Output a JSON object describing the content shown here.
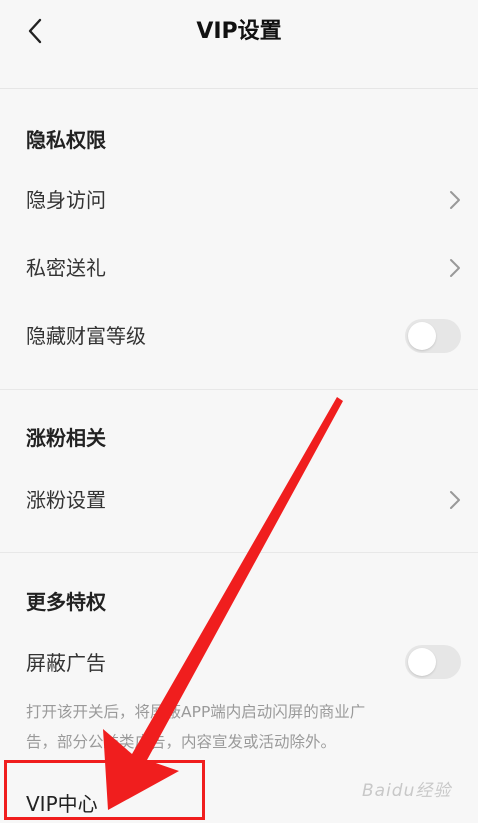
{
  "header": {
    "title": "VIP设置"
  },
  "sections": {
    "privacy": {
      "title": "隐私权限",
      "items": [
        {
          "label": "隐身访问"
        },
        {
          "label": "私密送礼"
        },
        {
          "label": "隐藏财富等级"
        }
      ]
    },
    "fans": {
      "title": "涨粉相关",
      "items": [
        {
          "label": "涨粉设置"
        }
      ]
    },
    "more": {
      "title": "更多特权",
      "items": [
        {
          "label": "屏蔽广告"
        }
      ],
      "description_line1": "打开该开关后，将屏蔽APP端内启动闪屏的商业广",
      "description_line2": "告，部分公益类广告，内容宣发或活动除外。"
    }
  },
  "vip_center": {
    "label": "VIP中心"
  },
  "toggles": {
    "hide_wealth_level": false,
    "block_ads": false
  },
  "colors": {
    "annotation": "#f01e1e",
    "toggle_off": "#e6e6e6"
  },
  "watermark": "Baidu经验"
}
